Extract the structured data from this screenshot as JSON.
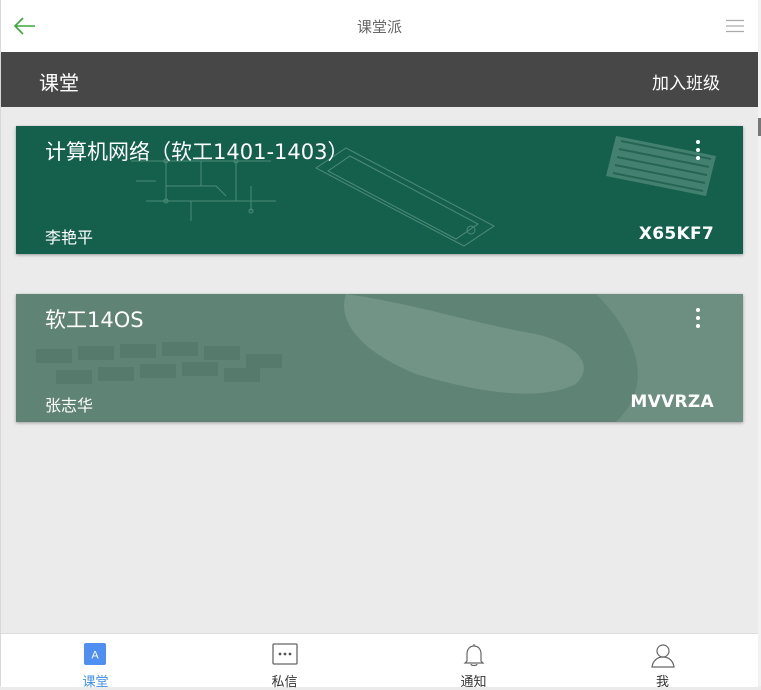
{
  "app": {
    "title": "课堂派"
  },
  "header": {
    "title": "课堂",
    "join_label": "加入班级"
  },
  "courses": [
    {
      "name": "计算机网络（软工1401-1403）",
      "teacher": "李艳平",
      "code": "X65KF7"
    },
    {
      "name": "软工14OS",
      "teacher": "张志华",
      "code": "MVVRZA"
    }
  ],
  "tabs": [
    {
      "label": "课堂",
      "icon_text": "A",
      "icon": "classroom-icon",
      "active": true
    },
    {
      "label": "私信",
      "icon": "message-icon",
      "active": false
    },
    {
      "label": "通知",
      "icon": "bell-icon",
      "active": false
    },
    {
      "label": "我",
      "icon": "user-icon",
      "active": false
    }
  ],
  "colors": {
    "accent": "#3d8ee8",
    "back_arrow": "#3aa83a",
    "header_bg": "#474747",
    "card1_bg": "#15604d",
    "card2_bg": "#5f8374"
  }
}
